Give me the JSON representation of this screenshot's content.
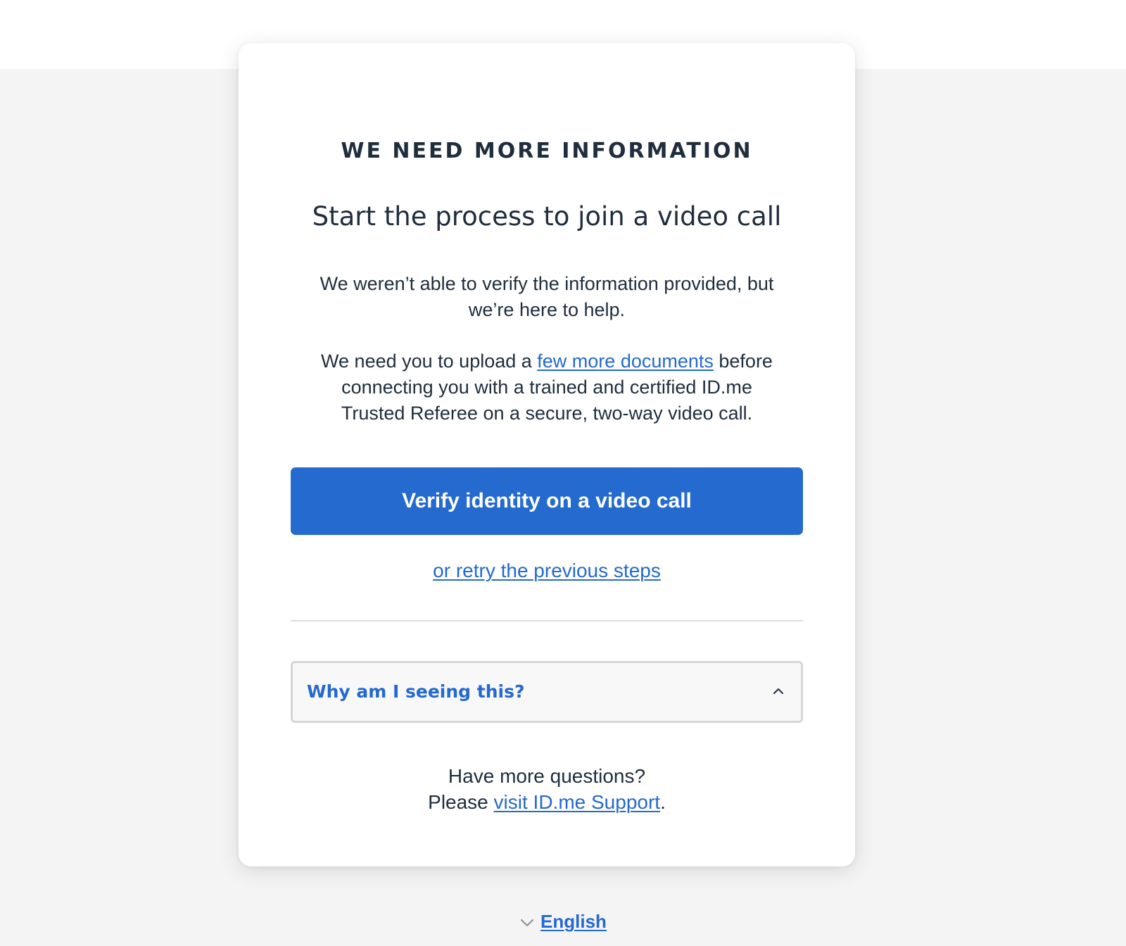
{
  "card": {
    "eyebrow": "WE NEED MORE INFORMATION",
    "title": "Start the process to join a video call",
    "intro": "We weren’t able to verify the information provided, but we’re here to help.",
    "upload_prefix": "We need you to upload a ",
    "upload_link": "few more documents",
    "upload_suffix": " before connecting you with a trained and certified ID.me Trusted Referee on a secure, two-way video call.",
    "primary_button": "Verify identity on a video call",
    "retry_link": "or retry the previous steps",
    "accordion_label": "Why am I seeing this?",
    "help_line1": "Have more questions?",
    "help_prefix": "Please ",
    "help_link": "visit ID.me Support",
    "help_suffix": "."
  },
  "footer": {
    "language": "English"
  },
  "colors": {
    "accent": "#256ace",
    "link": "#2469cf",
    "text": "#1f2d3d",
    "background": "#f4f4f4"
  },
  "icons": {
    "accordion": "chevron-up-icon",
    "language": "chevron-down-icon"
  }
}
